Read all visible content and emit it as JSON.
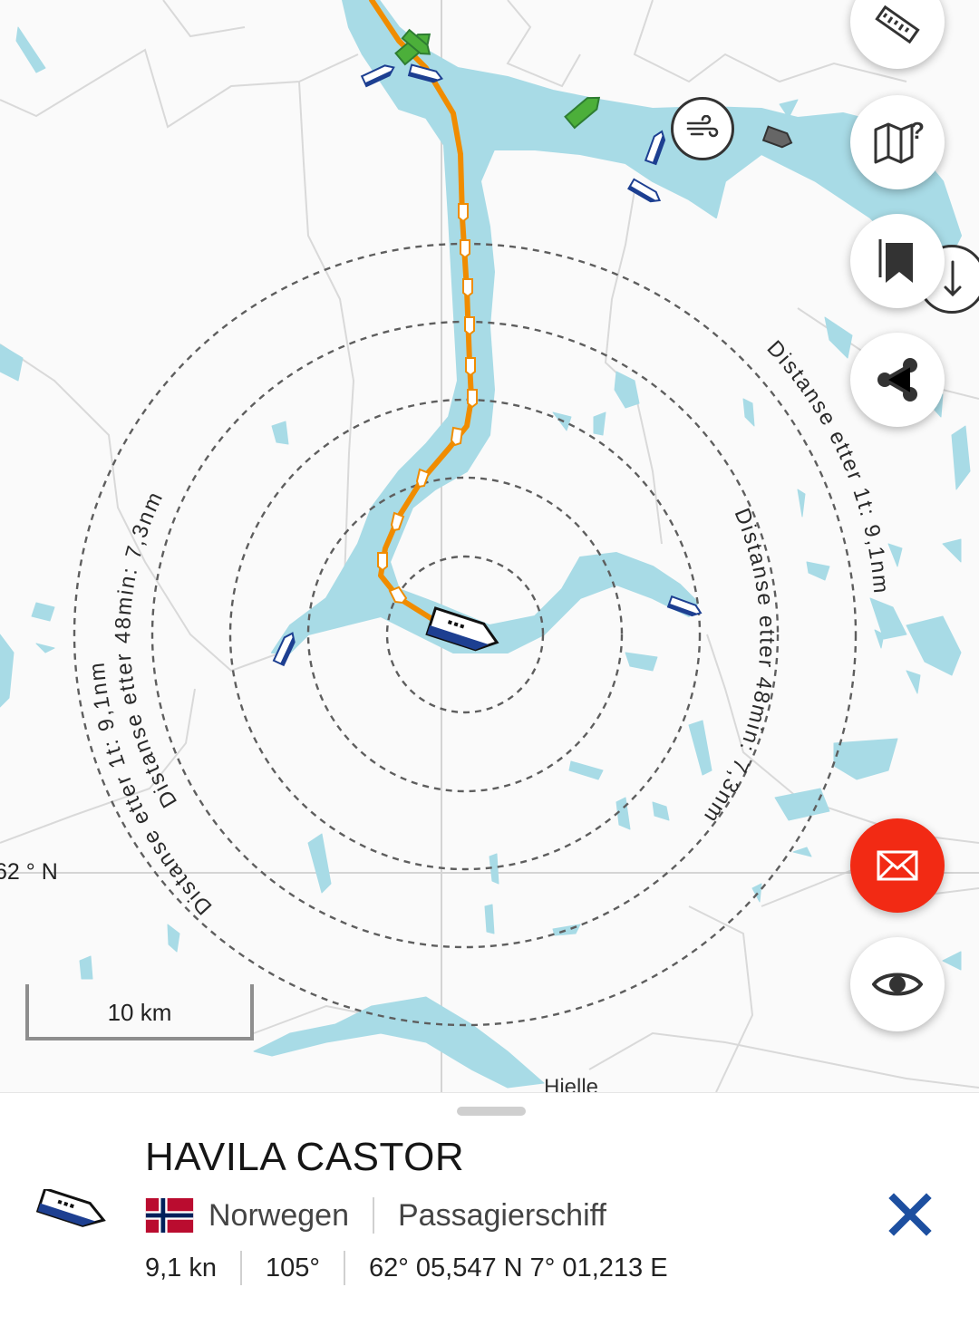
{
  "map": {
    "latitude_label": "62 ° N",
    "scale_label": "10 km",
    "town_label": "Hjelle",
    "ring_labels": {
      "outer_left": "Distanse etter 1t: 9,1nm",
      "inner_left": "Distanse etter 48min: 7,3nm",
      "outer_right": "Distanse etter 1t: 9,1nm",
      "inner_right": "Distanse etter 48min: 7,3nm"
    },
    "colors": {
      "water": "#a8dbe6",
      "route": "#f08c00",
      "ship_hull": "#1d3f91",
      "fishing_vessel": "#4caf3a"
    }
  },
  "toolbar": {
    "buttons": [
      {
        "name": "measure",
        "icon": "ruler-icon"
      },
      {
        "name": "map-layers",
        "icon": "map-question-icon"
      },
      {
        "name": "bookmarks",
        "icon": "bookmark-icon"
      },
      {
        "name": "share",
        "icon": "share-icon"
      },
      {
        "name": "message",
        "icon": "mail-icon",
        "color": "#f22a14"
      },
      {
        "name": "view",
        "icon": "eye-icon"
      }
    ],
    "overlay_icons": [
      "wind-icon",
      "arrow-down-icon"
    ]
  },
  "vessel": {
    "name": "HAVILA CASTOR",
    "flag": "norway-flag-icon",
    "country": "Norwegen",
    "type": "Passagierschiff",
    "speed": "9,1 kn",
    "course": "105°",
    "position": "62° 05,547 N 7° 01,213 E"
  }
}
